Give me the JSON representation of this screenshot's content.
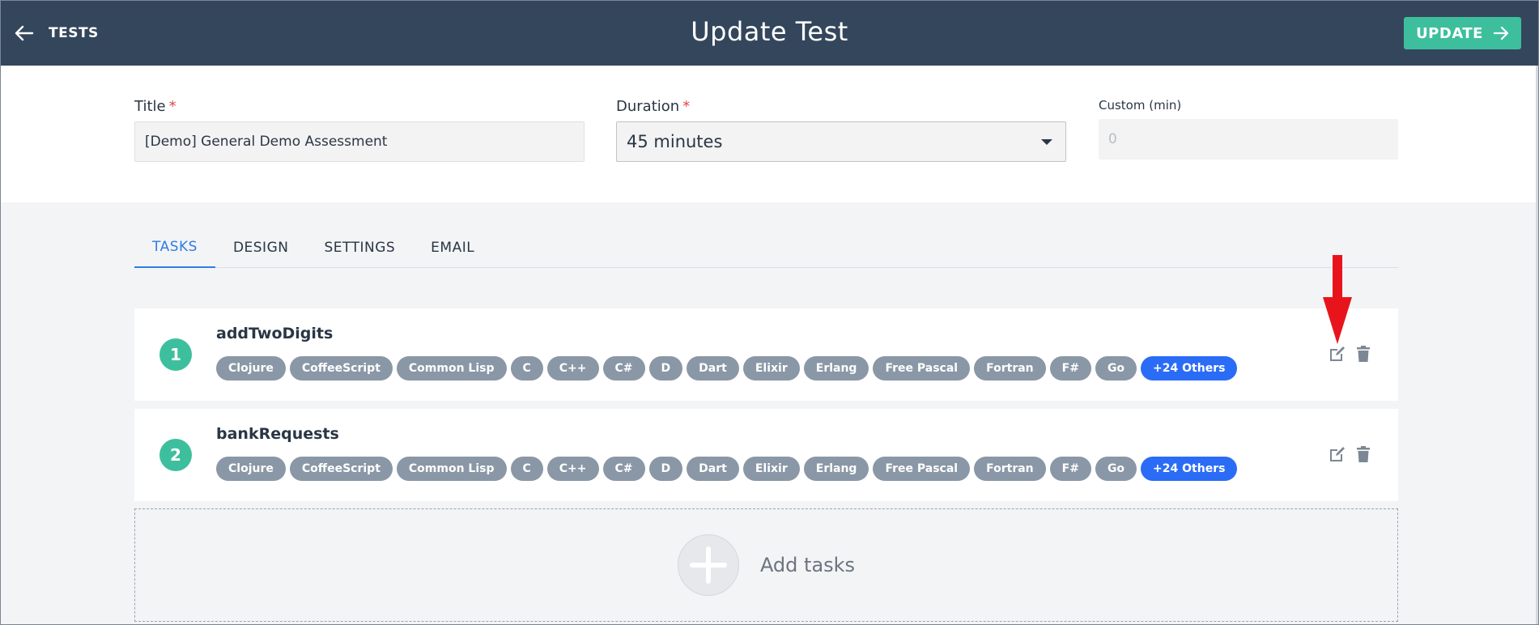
{
  "header": {
    "back_label": "TESTS",
    "title": "Update Test",
    "update_label": "UPDATE"
  },
  "form": {
    "title_label": "Title",
    "title_value": "[Demo] General Demo Assessment",
    "duration_label": "Duration",
    "duration_value": "45 minutes",
    "custom_label": "Custom (min)",
    "custom_placeholder": "0",
    "required_mark": "*"
  },
  "tabs": [
    {
      "label": "TASKS",
      "active": true
    },
    {
      "label": "DESIGN",
      "active": false
    },
    {
      "label": "SETTINGS",
      "active": false
    },
    {
      "label": "EMAIL",
      "active": false
    }
  ],
  "tasks": [
    {
      "number": "1",
      "name": "addTwoDigits",
      "languages": [
        "Clojure",
        "CoffeeScript",
        "Common Lisp",
        "C",
        "C++",
        "C#",
        "D",
        "Dart",
        "Elixir",
        "Erlang",
        "Free Pascal",
        "Fortran",
        "F#",
        "Go"
      ],
      "more_label": "+24 Others"
    },
    {
      "number": "2",
      "name": "bankRequests",
      "languages": [
        "Clojure",
        "CoffeeScript",
        "Common Lisp",
        "C",
        "C++",
        "C#",
        "D",
        "Dart",
        "Elixir",
        "Erlang",
        "Free Pascal",
        "Fortran",
        "F#",
        "Go"
      ],
      "more_label": "+24 Others"
    }
  ],
  "add_tasks_label": "Add tasks",
  "colors": {
    "header_bg": "#34465c",
    "accent_green": "#3dbf9d",
    "tab_active": "#2f7de1",
    "tag_gray": "#8a97a6",
    "tag_blue": "#2b6cf6",
    "annotation_red": "#e8141c"
  },
  "icons": {
    "back": "arrow-left-icon",
    "update": "arrow-right-icon",
    "edit": "edit-icon",
    "delete": "trash-icon",
    "add": "plus-icon",
    "dropdown": "caret-down-icon"
  }
}
